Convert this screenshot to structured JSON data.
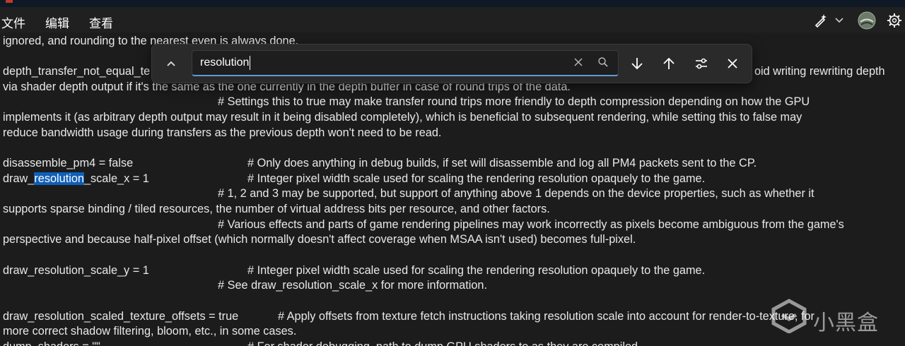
{
  "menubar": {
    "items": [
      "文件",
      "编辑",
      "查看"
    ]
  },
  "find": {
    "query": "resolution"
  },
  "lines": [
    {
      "t": "ignored, and rounding to the nearest even is always done."
    },
    {
      "t": "depth_transfer_not_equal_te",
      "r": "oid writing rewriting depth"
    },
    {
      "t": "via shader depth output if it's the same as the one currently in the depth buffer in case of round trips of the data."
    },
    {
      "c": "# Settings this to true may make transfer round trips more friendly to depth compression depending on how the GPU"
    },
    {
      "t": "implements it (as arbitrary depth output may result in it being disabled completely), which is beneficial to subsequent rendering, while setting this to false may"
    },
    {
      "t": "reduce bandwidth usage during transfers as the previous depth won't need to be read."
    },
    {
      "t": ""
    },
    {
      "t": "disassemble_pm4 = false",
      "c2": "# Only does anything in debug builds, if set will disassemble and log all PM4 packets sent to the CP."
    },
    {
      "pre": "draw_",
      "hl": "resolution",
      "post": "_scale_x = 1",
      "c2": "# Integer pixel width scale used for scaling the rendering resolution opaquely to the game."
    },
    {
      "c": "# 1, 2 and 3 may be supported, but support of anything above 1 depends on the device properties, such as whether it"
    },
    {
      "t": "supports sparse binding / tiled resources, the number of virtual address bits per resource, and other factors."
    },
    {
      "c": "# Various effects and parts of game rendering pipelines may work incorrectly as pixels become ambiguous from the game's"
    },
    {
      "t": "perspective and because half-pixel offset (which normally doesn't affect coverage when MSAA isn't used) becomes full-pixel."
    },
    {
      "t": ""
    },
    {
      "t": "draw_resolution_scale_y = 1",
      "c2": "# Integer pixel width scale used for scaling the rendering resolution opaquely to the game."
    },
    {
      "c": "# See draw_resolution_scale_x for more information."
    },
    {
      "t": ""
    },
    {
      "t": "draw_resolution_scaled_texture_offsets = true",
      "c3": "# Apply offsets from texture fetch instructions taking resolution scale into account for render-to-texture, for"
    },
    {
      "t": "more correct shadow filtering, bloom, etc., in some cases."
    },
    {
      "t": "dump_shaders = \"\"",
      "c2": "# For shader debugging, path to dump GPU shaders to as they are compiled."
    }
  ],
  "watermark": {
    "text": "小黑盒"
  },
  "icons": {
    "menu_right": [
      "sparkle-pen-icon",
      "chevron-down-icon",
      "avatar",
      "gear-icon"
    ],
    "find": [
      "chevron-up-icon",
      "clear-icon",
      "search-icon",
      "arrow-down-icon",
      "arrow-up-icon",
      "filter-options-icon",
      "close-icon"
    ]
  }
}
